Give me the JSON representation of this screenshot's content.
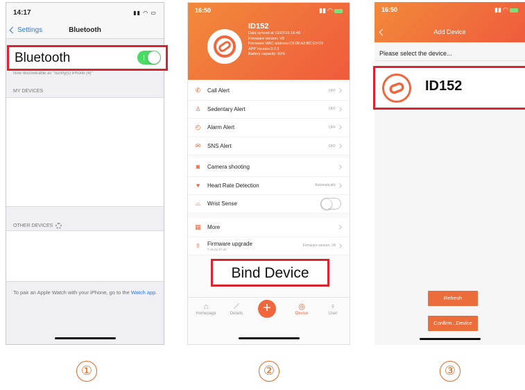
{
  "screen1": {
    "status_time": "14:17",
    "back_label": "Settings",
    "nav_title": "Bluetooth",
    "bluetooth_label": "Bluetooth",
    "bluetooth_on": true,
    "discoverable_hint": "Now discoverable as \"Sunny(s) iPhone (4)\"",
    "my_devices_header": "MY DEVICES",
    "other_devices_header": "OTHER DEVICES",
    "footer_text": "To pair an Apple Watch with your iPhone, go to the",
    "footer_link": "Watch app."
  },
  "screen2": {
    "status_time": "16:50",
    "device_name": "ID152",
    "device_info": [
      "Data synced at 19/07/16 16:48",
      "Firmware version: V8",
      "Firmware MAC address:C9:09:A3:BC:E0:D3",
      "APP Version:3.0.2",
      "Battery capacity: 93%"
    ],
    "alerts": [
      {
        "icon": "phone-icon",
        "glyph": "✆",
        "label": "Call Alert",
        "value": "OFF"
      },
      {
        "icon": "sedentary-icon",
        "glyph": "♙",
        "label": "Sedentary Alert",
        "value": "OFF"
      },
      {
        "icon": "alarm-clock-icon",
        "glyph": "◴",
        "label": "Alarm Alert",
        "value": "OFF"
      },
      {
        "icon": "message-icon",
        "glyph": "✉",
        "label": "SNS Alert",
        "value": "OFF"
      }
    ],
    "tools": [
      {
        "icon": "camera-icon",
        "glyph": "◙",
        "label": "Camera shooting",
        "value": ""
      },
      {
        "icon": "heart-rate-icon",
        "glyph": "♥",
        "label": "Heart Rate Detection",
        "value": "Automatically"
      }
    ],
    "wrist_sense": {
      "label": "Wrist Sense",
      "on": false
    },
    "more_label": "More",
    "firmware": {
      "label": "Firmware upgrade",
      "sub": "7.16.22.27.20",
      "value": "Firmware version: V8"
    },
    "bind_device_label": "Bind Device",
    "tabs": [
      {
        "label": "Homepage",
        "glyph": "⌂",
        "icon": "home-icon"
      },
      {
        "label": "Details",
        "glyph": "⟋",
        "icon": "chart-icon"
      },
      {
        "label": "Device",
        "glyph": "◎",
        "icon": "compass-icon"
      },
      {
        "label": "User",
        "glyph": "♀",
        "icon": "user-icon"
      }
    ],
    "plus_glyph": "+",
    "accent": "#f0663d"
  },
  "screen3": {
    "status_time": "16:50",
    "title": "Add Device",
    "prompt": "Please select the device...",
    "device_name": "ID152",
    "refresh_label": "Refresh",
    "confirm_label": "Confirm...Device"
  },
  "steps": [
    "①",
    "②",
    "③"
  ],
  "highlight_color": "#d9232e"
}
